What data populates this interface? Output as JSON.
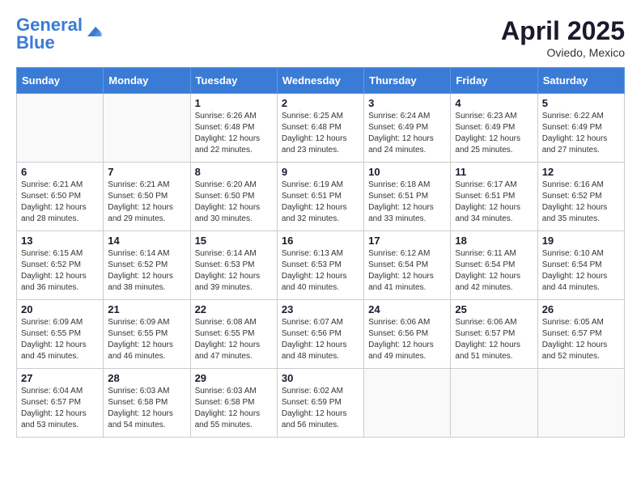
{
  "header": {
    "logo_line1": "General",
    "logo_line2": "Blue",
    "month": "April 2025",
    "location": "Oviedo, Mexico"
  },
  "days_of_week": [
    "Sunday",
    "Monday",
    "Tuesday",
    "Wednesday",
    "Thursday",
    "Friday",
    "Saturday"
  ],
  "weeks": [
    [
      {
        "day": "",
        "info": ""
      },
      {
        "day": "",
        "info": ""
      },
      {
        "day": "1",
        "info": "Sunrise: 6:26 AM\nSunset: 6:48 PM\nDaylight: 12 hours and 22 minutes."
      },
      {
        "day": "2",
        "info": "Sunrise: 6:25 AM\nSunset: 6:48 PM\nDaylight: 12 hours and 23 minutes."
      },
      {
        "day": "3",
        "info": "Sunrise: 6:24 AM\nSunset: 6:49 PM\nDaylight: 12 hours and 24 minutes."
      },
      {
        "day": "4",
        "info": "Sunrise: 6:23 AM\nSunset: 6:49 PM\nDaylight: 12 hours and 25 minutes."
      },
      {
        "day": "5",
        "info": "Sunrise: 6:22 AM\nSunset: 6:49 PM\nDaylight: 12 hours and 27 minutes."
      }
    ],
    [
      {
        "day": "6",
        "info": "Sunrise: 6:21 AM\nSunset: 6:50 PM\nDaylight: 12 hours and 28 minutes."
      },
      {
        "day": "7",
        "info": "Sunrise: 6:21 AM\nSunset: 6:50 PM\nDaylight: 12 hours and 29 minutes."
      },
      {
        "day": "8",
        "info": "Sunrise: 6:20 AM\nSunset: 6:50 PM\nDaylight: 12 hours and 30 minutes."
      },
      {
        "day": "9",
        "info": "Sunrise: 6:19 AM\nSunset: 6:51 PM\nDaylight: 12 hours and 32 minutes."
      },
      {
        "day": "10",
        "info": "Sunrise: 6:18 AM\nSunset: 6:51 PM\nDaylight: 12 hours and 33 minutes."
      },
      {
        "day": "11",
        "info": "Sunrise: 6:17 AM\nSunset: 6:51 PM\nDaylight: 12 hours and 34 minutes."
      },
      {
        "day": "12",
        "info": "Sunrise: 6:16 AM\nSunset: 6:52 PM\nDaylight: 12 hours and 35 minutes."
      }
    ],
    [
      {
        "day": "13",
        "info": "Sunrise: 6:15 AM\nSunset: 6:52 PM\nDaylight: 12 hours and 36 minutes."
      },
      {
        "day": "14",
        "info": "Sunrise: 6:14 AM\nSunset: 6:52 PM\nDaylight: 12 hours and 38 minutes."
      },
      {
        "day": "15",
        "info": "Sunrise: 6:14 AM\nSunset: 6:53 PM\nDaylight: 12 hours and 39 minutes."
      },
      {
        "day": "16",
        "info": "Sunrise: 6:13 AM\nSunset: 6:53 PM\nDaylight: 12 hours and 40 minutes."
      },
      {
        "day": "17",
        "info": "Sunrise: 6:12 AM\nSunset: 6:54 PM\nDaylight: 12 hours and 41 minutes."
      },
      {
        "day": "18",
        "info": "Sunrise: 6:11 AM\nSunset: 6:54 PM\nDaylight: 12 hours and 42 minutes."
      },
      {
        "day": "19",
        "info": "Sunrise: 6:10 AM\nSunset: 6:54 PM\nDaylight: 12 hours and 44 minutes."
      }
    ],
    [
      {
        "day": "20",
        "info": "Sunrise: 6:09 AM\nSunset: 6:55 PM\nDaylight: 12 hours and 45 minutes."
      },
      {
        "day": "21",
        "info": "Sunrise: 6:09 AM\nSunset: 6:55 PM\nDaylight: 12 hours and 46 minutes."
      },
      {
        "day": "22",
        "info": "Sunrise: 6:08 AM\nSunset: 6:55 PM\nDaylight: 12 hours and 47 minutes."
      },
      {
        "day": "23",
        "info": "Sunrise: 6:07 AM\nSunset: 6:56 PM\nDaylight: 12 hours and 48 minutes."
      },
      {
        "day": "24",
        "info": "Sunrise: 6:06 AM\nSunset: 6:56 PM\nDaylight: 12 hours and 49 minutes."
      },
      {
        "day": "25",
        "info": "Sunrise: 6:06 AM\nSunset: 6:57 PM\nDaylight: 12 hours and 51 minutes."
      },
      {
        "day": "26",
        "info": "Sunrise: 6:05 AM\nSunset: 6:57 PM\nDaylight: 12 hours and 52 minutes."
      }
    ],
    [
      {
        "day": "27",
        "info": "Sunrise: 6:04 AM\nSunset: 6:57 PM\nDaylight: 12 hours and 53 minutes."
      },
      {
        "day": "28",
        "info": "Sunrise: 6:03 AM\nSunset: 6:58 PM\nDaylight: 12 hours and 54 minutes."
      },
      {
        "day": "29",
        "info": "Sunrise: 6:03 AM\nSunset: 6:58 PM\nDaylight: 12 hours and 55 minutes."
      },
      {
        "day": "30",
        "info": "Sunrise: 6:02 AM\nSunset: 6:59 PM\nDaylight: 12 hours and 56 minutes."
      },
      {
        "day": "",
        "info": ""
      },
      {
        "day": "",
        "info": ""
      },
      {
        "day": "",
        "info": ""
      }
    ]
  ]
}
